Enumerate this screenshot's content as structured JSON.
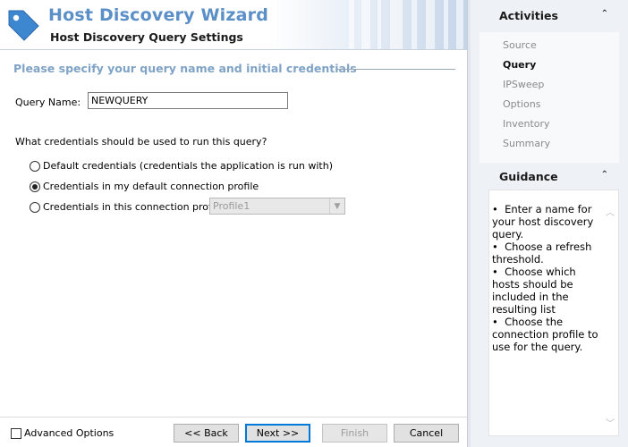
{
  "header": {
    "title": "Host Discovery Wizard",
    "subtitle": "Host Discovery Query Settings"
  },
  "form": {
    "section_heading": "Please specify your query name and initial credentials",
    "query_name_label": "Query Name:",
    "query_name_value": "NEWQUERY",
    "credentials_question": "What credentials should be used to run this query?",
    "options": [
      {
        "label": "Default credentials (credentials the application is run with)",
        "selected": false
      },
      {
        "label": "Credentials in my default connection profile",
        "selected": true
      },
      {
        "label": "Credentials in this connection profile:",
        "selected": false
      }
    ],
    "profile_select_value": "Profile1"
  },
  "footer": {
    "advanced_options_label": "Advanced Options",
    "advanced_options_checked": false,
    "back_label": "<< Back",
    "next_label": "Next >>",
    "finish_label": "Finish",
    "cancel_label": "Cancel"
  },
  "activities": {
    "title": "Activities",
    "items": [
      {
        "label": "Source",
        "current": false
      },
      {
        "label": "Query",
        "current": true
      },
      {
        "label": "IPSweep",
        "current": false
      },
      {
        "label": "Options",
        "current": false
      },
      {
        "label": "Inventory",
        "current": false
      },
      {
        "label": "Summary",
        "current": false
      }
    ]
  },
  "guidance": {
    "title": "Guidance",
    "bullets": [
      "Enter a name for your host discovery query.",
      "Choose a refresh threshold.",
      "Choose which hosts should be included in the resulting list",
      "Choose the connection profile to use for the query."
    ]
  },
  "colors": {
    "title_blue": "#5b8fc7",
    "section_heading": "#7fa3c6",
    "primary_button_border": "#0078d7"
  }
}
